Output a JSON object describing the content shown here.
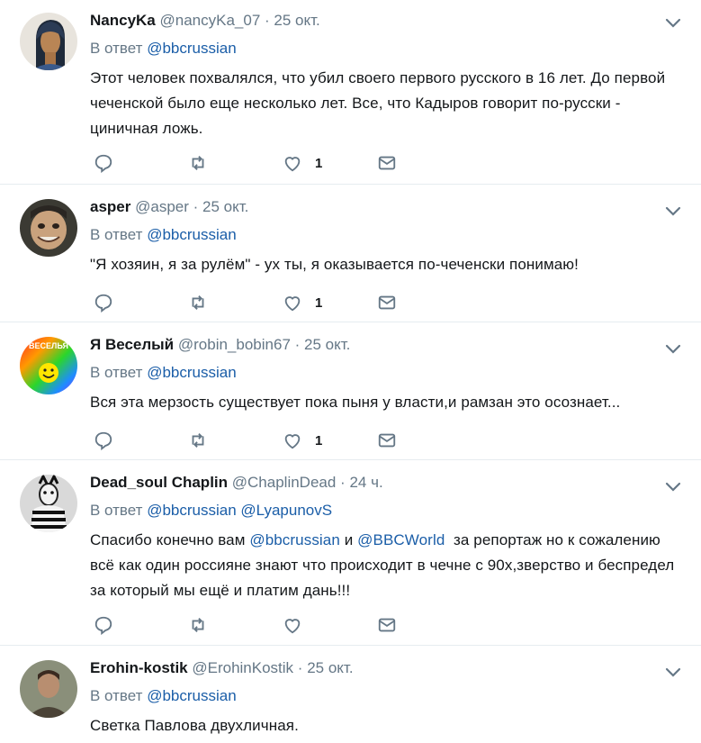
{
  "reply_prefix": "В ответ",
  "tweets": [
    {
      "name": "NancyKa",
      "handle": "@nancyKa_07",
      "time": "25 окт.",
      "reply_to": [
        "@bbcrussian"
      ],
      "text_parts": [
        "Этот человек похвалялся, что убил своего первого русского в 16 лет. До первой чеченской было еще несколько лет. Все, что Кадыров говорит по-русски - циничная ложь."
      ],
      "likes": "1",
      "avatar_icon": "egyptian-portrait"
    },
    {
      "name": "asper",
      "handle": "@asper",
      "time": "25 окт.",
      "reply_to": [
        "@bbcrussian"
      ],
      "text_parts": [
        "\"Я хозяин, я за рулём\" - ух ты, я оказывается по-чеченски понимаю!"
      ],
      "likes": "1",
      "avatar_icon": "grinning-man"
    },
    {
      "name": "Я Веселый",
      "handle": "@robin_bobin67",
      "time": "25 окт.",
      "reply_to": [
        "@bbcrussian"
      ],
      "text_parts": [
        "Вся эта мерзость существует пока пыня у власти,и рамзан это осознает..."
      ],
      "likes": "1",
      "avatar_text": "ВЕСЕЛЬЯ",
      "avatar_icon": "rainbow-smiley"
    },
    {
      "name": "Dead_soul Chaplin",
      "handle": "@ChaplinDead",
      "time": "24 ч.",
      "reply_to": [
        "@bbcrussian",
        "@LyapunovS"
      ],
      "text_parts": [
        "Спасибо конечно вам ",
        "@bbcrussian",
        " и ",
        "@BBCWorld",
        "  за репортаж но к сожалению всё как один россияне знают что происходит в чечне с 90х,зверство и беспредел за который мы ещё и платим дань!!!"
      ],
      "likes": "",
      "avatar_icon": "striped-figure"
    },
    {
      "name": "Erohin-kostik",
      "handle": "@ErohinKostik",
      "time": "25 окт.",
      "reply_to": [
        "@bbcrussian"
      ],
      "text_parts": [
        "Светка Павлова двухличная."
      ],
      "likes": "",
      "avatar_icon": "man-portrait"
    }
  ]
}
